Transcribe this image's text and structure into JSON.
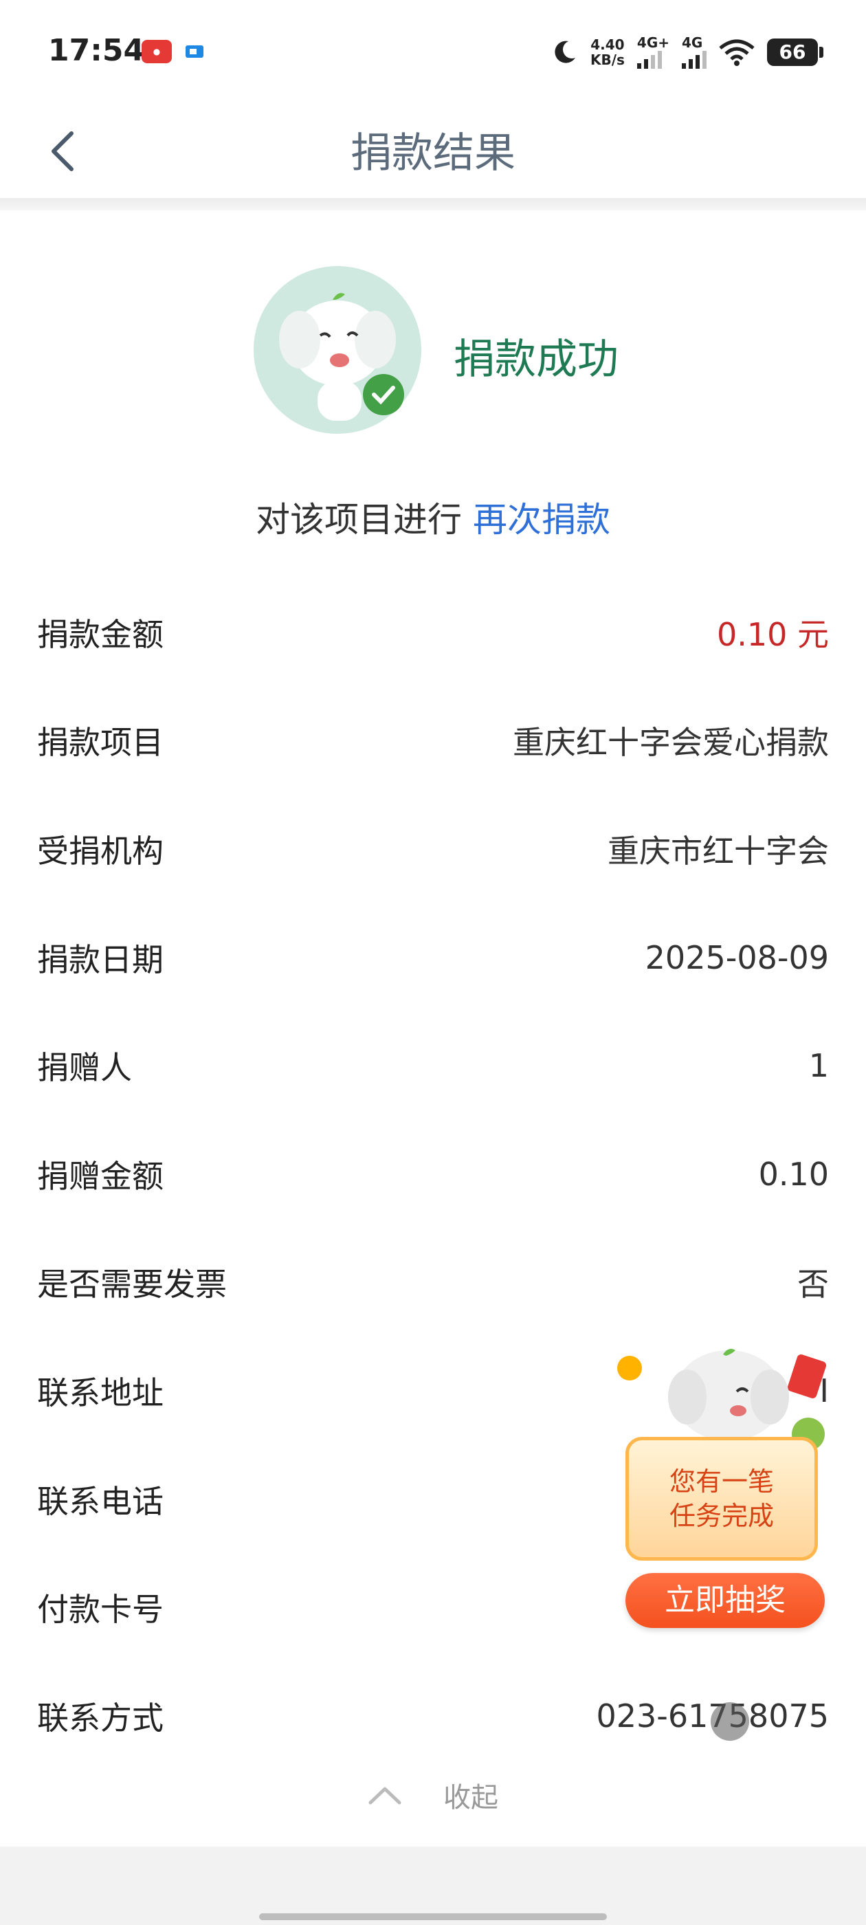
{
  "status_bar": {
    "time": "17:54",
    "net_speed_value": "4.40",
    "net_speed_unit": "KB/s",
    "sim1": "4G+",
    "sim2": "4G",
    "battery": "66"
  },
  "nav": {
    "title": "捐款结果"
  },
  "result": {
    "status_text": "捐款成功",
    "again_prefix": "对该项目进行",
    "again_link": "再次捐款"
  },
  "details": [
    {
      "label": "捐款金额",
      "value": "0.10 元",
      "highlight": true
    },
    {
      "label": "捐款项目",
      "value": "重庆红十字会爱心捐款"
    },
    {
      "label": "受捐机构",
      "value": "重庆市红十字会"
    },
    {
      "label": "捐款日期",
      "value": "2025-08-09"
    },
    {
      "label": "捐赠人",
      "value": "1"
    },
    {
      "label": "捐赠金额",
      "value": "0.10"
    },
    {
      "label": "是否需要发票",
      "value": "否"
    },
    {
      "label": "联系地址",
      "value": "I"
    },
    {
      "label": "联系电话",
      "value": ""
    },
    {
      "label": "付款卡号",
      "value": ""
    },
    {
      "label": "联系方式",
      "value": "023-61758075"
    }
  ],
  "collapse_label": "收起",
  "promo": {
    "line1": "您有一笔",
    "line2": "任务完成",
    "button": "立即抽奖"
  },
  "colors": {
    "success_green": "#1e7a53",
    "link_blue": "#2e6fd8",
    "amount_red": "#c62828",
    "promo_orange": "#f4511e"
  }
}
